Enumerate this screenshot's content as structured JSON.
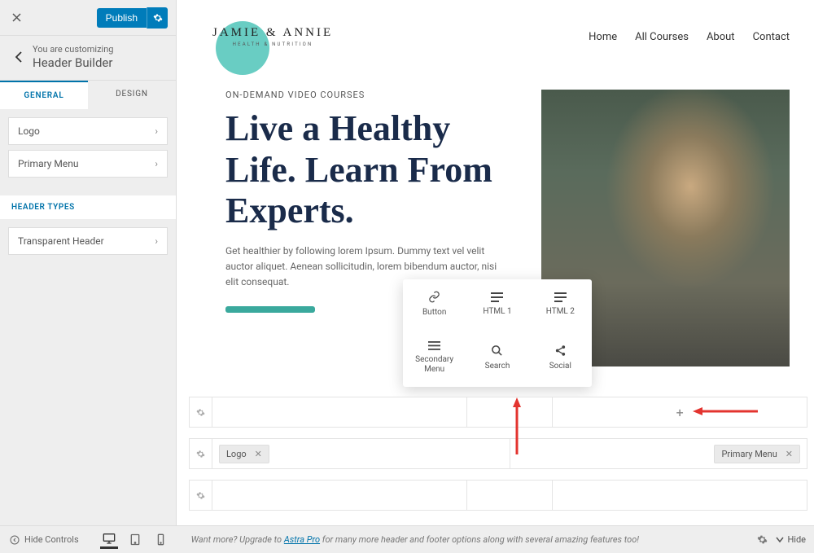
{
  "sidebar": {
    "publish_label": "Publish",
    "customizing_label": "You are customizing",
    "section_title": "Header Builder",
    "tabs": {
      "general": "GENERAL",
      "design": "DESIGN"
    },
    "items": [
      "Logo",
      "Primary Menu"
    ],
    "header_types_label": "HEADER TYPES",
    "header_type_items": [
      "Transparent Header"
    ]
  },
  "site": {
    "logo_title": "JAMIE & ANNIE",
    "logo_sub": "HEALTH & NUTRITION",
    "nav": [
      "Home",
      "All Courses",
      "About",
      "Contact"
    ]
  },
  "hero": {
    "eyebrow": "ON-DEMAND VIDEO COURSES",
    "title": "Live a Healthy Life. Learn From Experts.",
    "body": "Get healthier by following lorem Ipsum. Dummy text vel velit auctor aliquet. Aenean sollicitudin, lorem bibendum auctor, nisi elit consequat."
  },
  "popup": {
    "items": [
      {
        "icon": "link",
        "label": "Button"
      },
      {
        "icon": "lines",
        "label": "HTML 1"
      },
      {
        "icon": "lines",
        "label": "HTML 2"
      },
      {
        "icon": "menu",
        "label": "Secondary Menu"
      },
      {
        "icon": "search",
        "label": "Search"
      },
      {
        "icon": "share",
        "label": "Social"
      }
    ]
  },
  "builder": {
    "logo_chip": "Logo",
    "menu_chip": "Primary Menu"
  },
  "bottom": {
    "hide_controls": "Hide Controls",
    "msg_prefix": "Want more? Upgrade to ",
    "msg_link": "Astra Pro",
    "msg_suffix": " for many more header and footer options along with several amazing features too!",
    "hide_label": "Hide"
  }
}
